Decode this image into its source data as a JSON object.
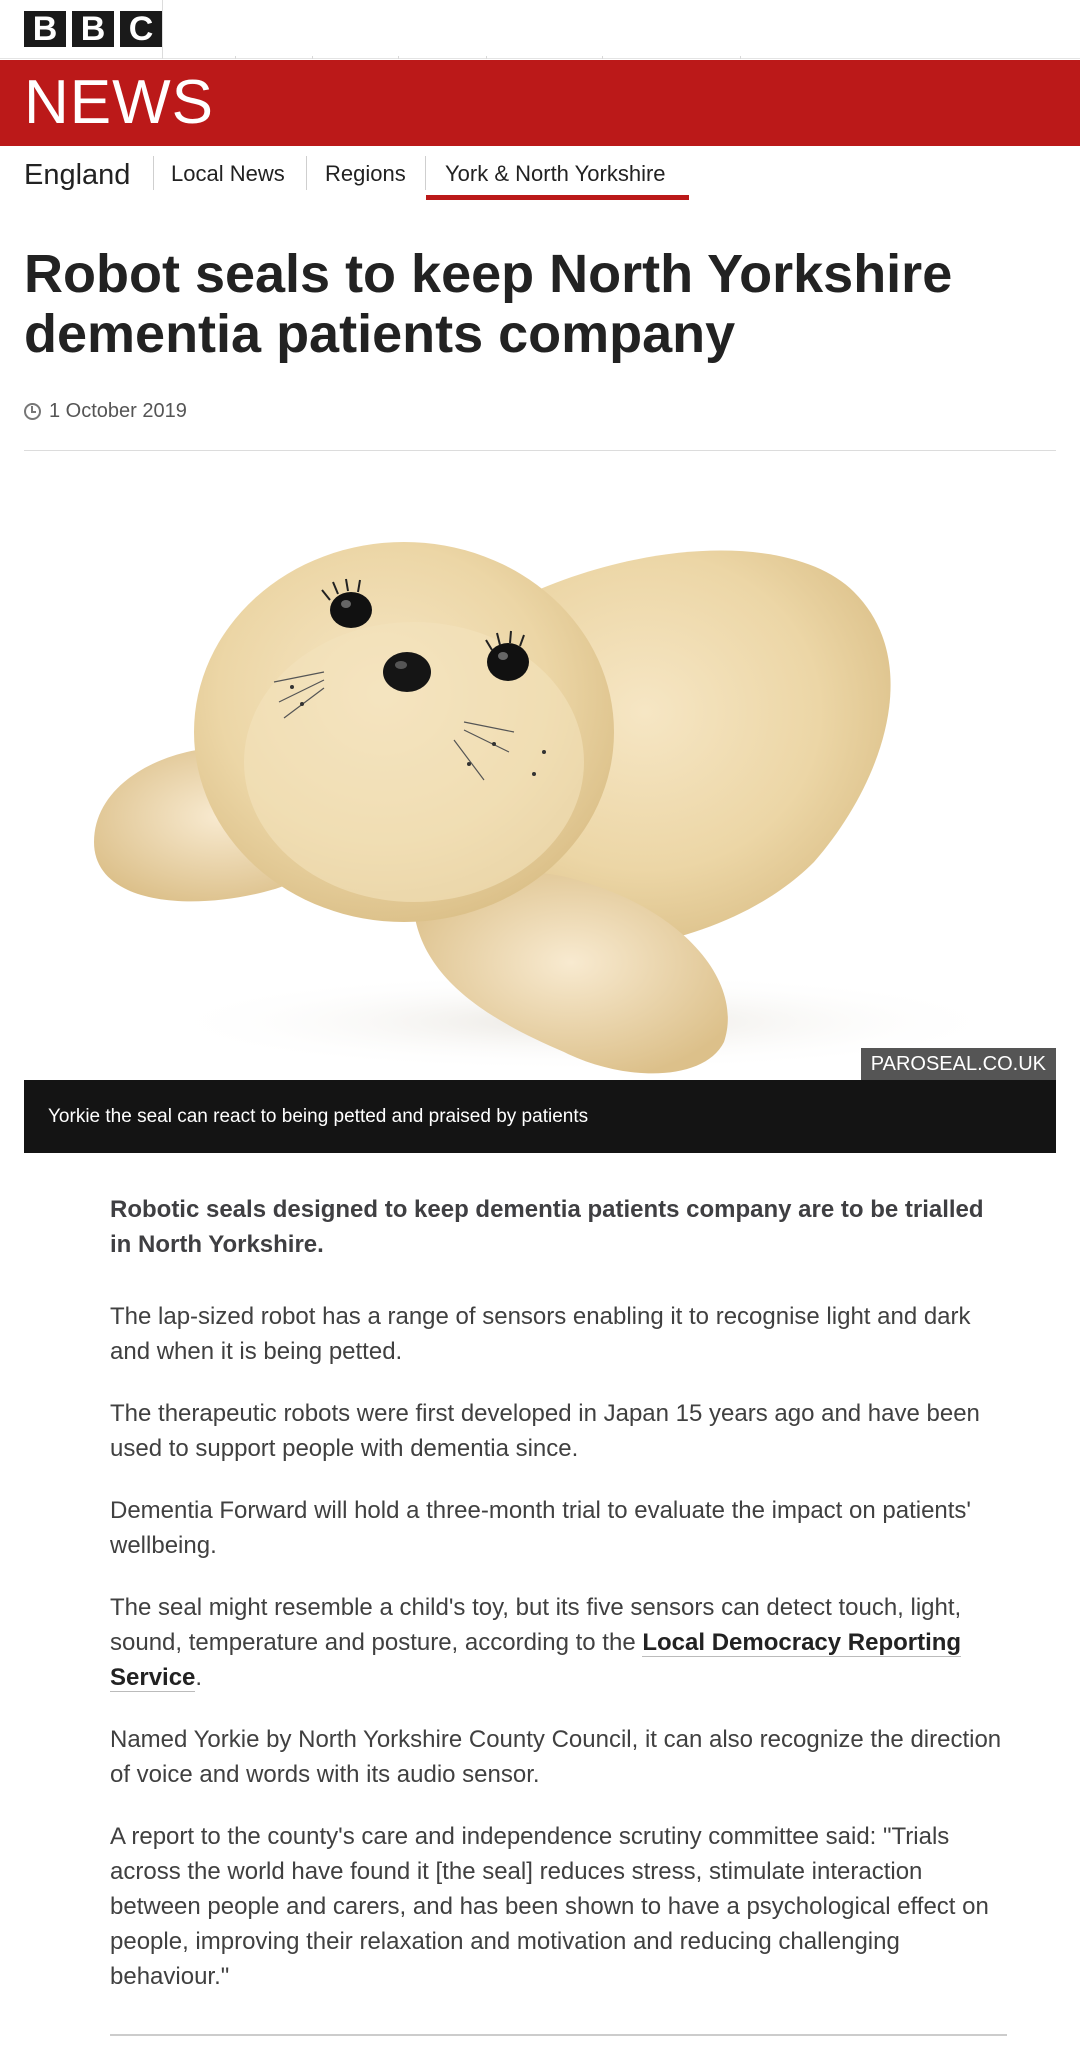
{
  "brand": {
    "bbc_letters": [
      "B",
      "B",
      "C"
    ],
    "news_title": "NEWS",
    "accent_red": "#bb1919"
  },
  "section_nav": {
    "primary": "England",
    "items": [
      "Local News",
      "Regions",
      "York & North Yorkshire"
    ],
    "active": "York & North Yorkshire"
  },
  "article": {
    "headline": "Robot seals to keep North Yorkshire dementia patients company",
    "date": "1 October 2019",
    "image": {
      "credit": "PAROSEAL.CO.UK",
      "caption": "Yorkie the seal can react to being petted and praised by patients"
    },
    "intro": "Robotic seals designed to keep dementia patients company are to be trialled in North Yorkshire.",
    "paragraphs": [
      "The lap-sized robot has a range of sensors enabling it to recognise light and dark and when it is being petted.",
      "The therapeutic robots were first developed in Japan 15 years ago and have been used to support people with dementia since.",
      "Dementia Forward will hold a three-month trial to evaluate the impact on patients' wellbeing."
    ],
    "link_paragraph": {
      "before": "The seal might resemble a child's toy, but its five sensors can detect touch, light, sound, temperature and posture, according to the ",
      "link": "Local Democracy Reporting Service",
      "after": "."
    },
    "paragraphs_after": [
      "Named Yorkie by North Yorkshire County Council, it can also recognize the direction of voice and words with its audio sensor.",
      "A report to the county's care and independence scrutiny committee said: \"Trials across the world have found it [the seal] reduces stress, stimulate interaction between people and carers, and has been shown to have a psychological effect on people, improving their relaxation and motivation and reducing challenging behaviour.\""
    ]
  }
}
